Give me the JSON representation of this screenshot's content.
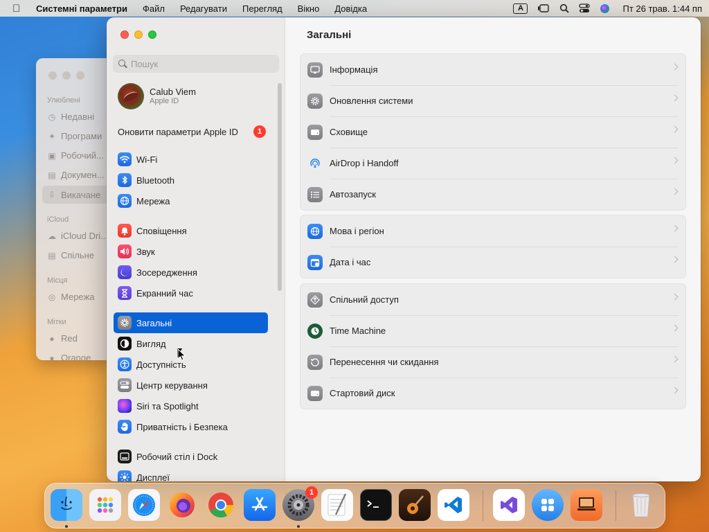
{
  "menubar": {
    "app_name": "Системні параметри",
    "menus": [
      "Файл",
      "Редагувати",
      "Перегляд",
      "Вікно",
      "Довідка"
    ],
    "input_source": "A",
    "clock": "Пт 26 трав.  1:44 пп"
  },
  "finder": {
    "sections": {
      "favorites": "Улюблені",
      "icloud": "iCloud",
      "locations": "Місця",
      "tags": "Мітки"
    },
    "items": {
      "recents": "Недавні",
      "applications": "Програми",
      "desktop": "Робочий...",
      "documents": "Докумен...",
      "downloads": "Викачане",
      "icloud_drive": "iCloud Dri...",
      "shared": "Спільне",
      "network": "Мережа",
      "tag_red": "Red",
      "tag_orange": "Orange"
    }
  },
  "sidebar": {
    "search_placeholder": "Пошук",
    "profile": {
      "name": "Calub Viem",
      "subtitle": "Apple ID"
    },
    "update": {
      "label": "Оновити параметри Apple ID",
      "badge": "1"
    },
    "groups": [
      [
        {
          "label": "Wi-Fi",
          "icon": "wifi-icon"
        },
        {
          "label": "Bluetooth",
          "icon": "bluetooth-icon"
        },
        {
          "label": "Мережа",
          "icon": "globe-icon"
        }
      ],
      [
        {
          "label": "Сповіщення",
          "icon": "bell-icon"
        },
        {
          "label": "Звук",
          "icon": "speaker-icon"
        },
        {
          "label": "Зосередження",
          "icon": "moon-icon"
        },
        {
          "label": "Екранний час",
          "icon": "hourglass-icon"
        }
      ],
      [
        {
          "label": "Загальні",
          "icon": "gear-icon",
          "selected": true
        },
        {
          "label": "Вигляд",
          "icon": "appearance-icon"
        },
        {
          "label": "Доступність",
          "icon": "accessibility-icon"
        },
        {
          "label": "Центр керування",
          "icon": "control-center-icon"
        },
        {
          "label": "Siri та Spotlight",
          "icon": "siri-icon"
        },
        {
          "label": "Приватність і Безпека",
          "icon": "hand-icon"
        }
      ],
      [
        {
          "label": "Робочий стіл і Dock",
          "icon": "dock-icon"
        },
        {
          "label": "Дисплеї",
          "icon": "sun-icon"
        }
      ]
    ]
  },
  "content": {
    "title": "Загальні",
    "groups": [
      [
        {
          "label": "Інформація",
          "icon": "info-icon"
        },
        {
          "label": "Оновлення системи",
          "icon": "gear-badge-icon"
        },
        {
          "label": "Сховище",
          "icon": "disk-icon"
        },
        {
          "label": "AirDrop і Handoff",
          "icon": "airdrop-icon"
        },
        {
          "label": "Автозапуск",
          "icon": "list-icon"
        }
      ],
      [
        {
          "label": "Мова і регіон",
          "icon": "globe-icon"
        },
        {
          "label": "Дата і час",
          "icon": "calendar-icon"
        }
      ],
      [
        {
          "label": "Спільний доступ",
          "icon": "sharing-icon"
        },
        {
          "label": "Time Machine",
          "icon": "time-machine-icon"
        },
        {
          "label": "Перенесення чи скидання",
          "icon": "reset-icon"
        },
        {
          "label": "Стартовий диск",
          "icon": "startup-disk-icon"
        }
      ]
    ]
  },
  "dock": {
    "apps": [
      "finder-icon",
      "launchpad-icon",
      "safari-icon",
      "firefox-icon",
      "chrome-icon",
      "app-store-icon",
      "system-settings-icon",
      "textedit-icon",
      "terminal-icon",
      "garageband-icon",
      "vscode-icon",
      "visual-studio-icon",
      "app-folder-icon",
      "remote-desktop-icon",
      "trash-icon"
    ],
    "settings_badge": "1"
  }
}
